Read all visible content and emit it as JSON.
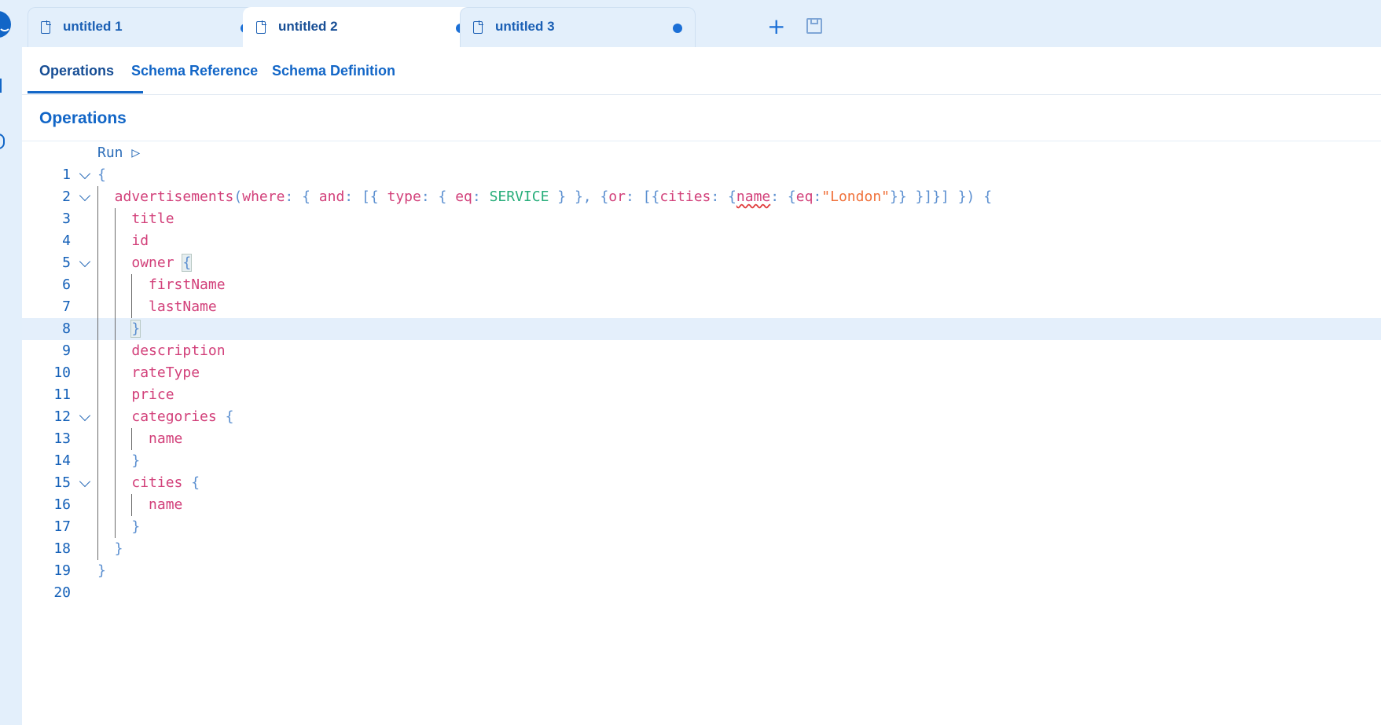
{
  "tabs": [
    {
      "label": "untitled 1",
      "active": false,
      "unsaved": true
    },
    {
      "label": "untitled 2",
      "active": true,
      "unsaved": true
    },
    {
      "label": "untitled 3",
      "active": false,
      "unsaved": true
    }
  ],
  "subtabs": [
    "Operations",
    "Schema Reference",
    "Schema Definition"
  ],
  "section_title": "Operations",
  "run_label": "Run ▷",
  "current_line": 8,
  "lines": [
    {
      "n": "1",
      "fold": true,
      "indent": 0,
      "tokens": [
        [
          "p",
          "{"
        ]
      ]
    },
    {
      "n": "2",
      "fold": true,
      "indent": 1,
      "tokens": [
        [
          "f",
          "advertisements"
        ],
        [
          "p",
          "("
        ],
        [
          "f",
          "where"
        ],
        [
          "p",
          ": { "
        ],
        [
          "f",
          "and"
        ],
        [
          "p",
          ": [{ "
        ],
        [
          "f",
          "type"
        ],
        [
          "p",
          ": { "
        ],
        [
          "f",
          "eq"
        ],
        [
          "p",
          ": "
        ],
        [
          "e",
          "SERVICE"
        ],
        [
          "p",
          " } }, {"
        ],
        [
          "f",
          "or"
        ],
        [
          "p",
          ": [{"
        ],
        [
          "f",
          "cities"
        ],
        [
          "p",
          ": {"
        ],
        [
          "fw",
          "name"
        ],
        [
          "p",
          ": {"
        ],
        [
          "f",
          "eq"
        ],
        [
          "p",
          ":"
        ],
        [
          "s",
          "\"London\""
        ],
        [
          "p",
          "}} }]}] }) {"
        ]
      ]
    },
    {
      "n": "3",
      "fold": false,
      "indent": 2,
      "tokens": [
        [
          "f",
          "title"
        ]
      ]
    },
    {
      "n": "4",
      "fold": false,
      "indent": 2,
      "tokens": [
        [
          "f",
          "id"
        ]
      ]
    },
    {
      "n": "5",
      "fold": true,
      "indent": 2,
      "tokens": [
        [
          "f",
          "owner "
        ],
        [
          "ph",
          "{"
        ]
      ]
    },
    {
      "n": "6",
      "fold": false,
      "indent": 3,
      "tokens": [
        [
          "f",
          "firstName"
        ]
      ]
    },
    {
      "n": "7",
      "fold": false,
      "indent": 3,
      "tokens": [
        [
          "f",
          "lastName"
        ]
      ]
    },
    {
      "n": "8",
      "fold": false,
      "indent": 2,
      "tokens": [
        [
          "ph",
          "}"
        ]
      ]
    },
    {
      "n": "9",
      "fold": false,
      "indent": 2,
      "tokens": [
        [
          "f",
          "description"
        ]
      ]
    },
    {
      "n": "10",
      "fold": false,
      "indent": 2,
      "tokens": [
        [
          "f",
          "rateType"
        ]
      ]
    },
    {
      "n": "11",
      "fold": false,
      "indent": 2,
      "tokens": [
        [
          "f",
          "price"
        ]
      ]
    },
    {
      "n": "12",
      "fold": true,
      "indent": 2,
      "tokens": [
        [
          "f",
          "categories "
        ],
        [
          "p",
          "{"
        ]
      ]
    },
    {
      "n": "13",
      "fold": false,
      "indent": 3,
      "tokens": [
        [
          "f",
          "name"
        ]
      ]
    },
    {
      "n": "14",
      "fold": false,
      "indent": 2,
      "tokens": [
        [
          "p",
          "}"
        ]
      ]
    },
    {
      "n": "15",
      "fold": true,
      "indent": 2,
      "tokens": [
        [
          "f",
          "cities "
        ],
        [
          "p",
          "{"
        ]
      ]
    },
    {
      "n": "16",
      "fold": false,
      "indent": 3,
      "tokens": [
        [
          "f",
          "name"
        ]
      ]
    },
    {
      "n": "17",
      "fold": false,
      "indent": 2,
      "tokens": [
        [
          "p",
          "}"
        ]
      ]
    },
    {
      "n": "18",
      "fold": false,
      "indent": 1,
      "tokens": [
        [
          "p",
          "}"
        ]
      ]
    },
    {
      "n": "19",
      "fold": false,
      "indent": 0,
      "tokens": [
        [
          "p",
          "}"
        ]
      ]
    },
    {
      "n": "20",
      "fold": false,
      "indent": 0,
      "tokens": []
    }
  ],
  "colors": {
    "field": "#d2407a",
    "punctuation": "#5b8fd0",
    "enum": "#27ad7a",
    "string": "#f0713a",
    "accent": "#1266c7"
  },
  "icons": {
    "tab_file": "file-icon",
    "tab_dirty": "unsaved-dot-icon",
    "new_tab": "plus-icon",
    "save": "save-icon",
    "fold": "chevron-down-icon"
  }
}
